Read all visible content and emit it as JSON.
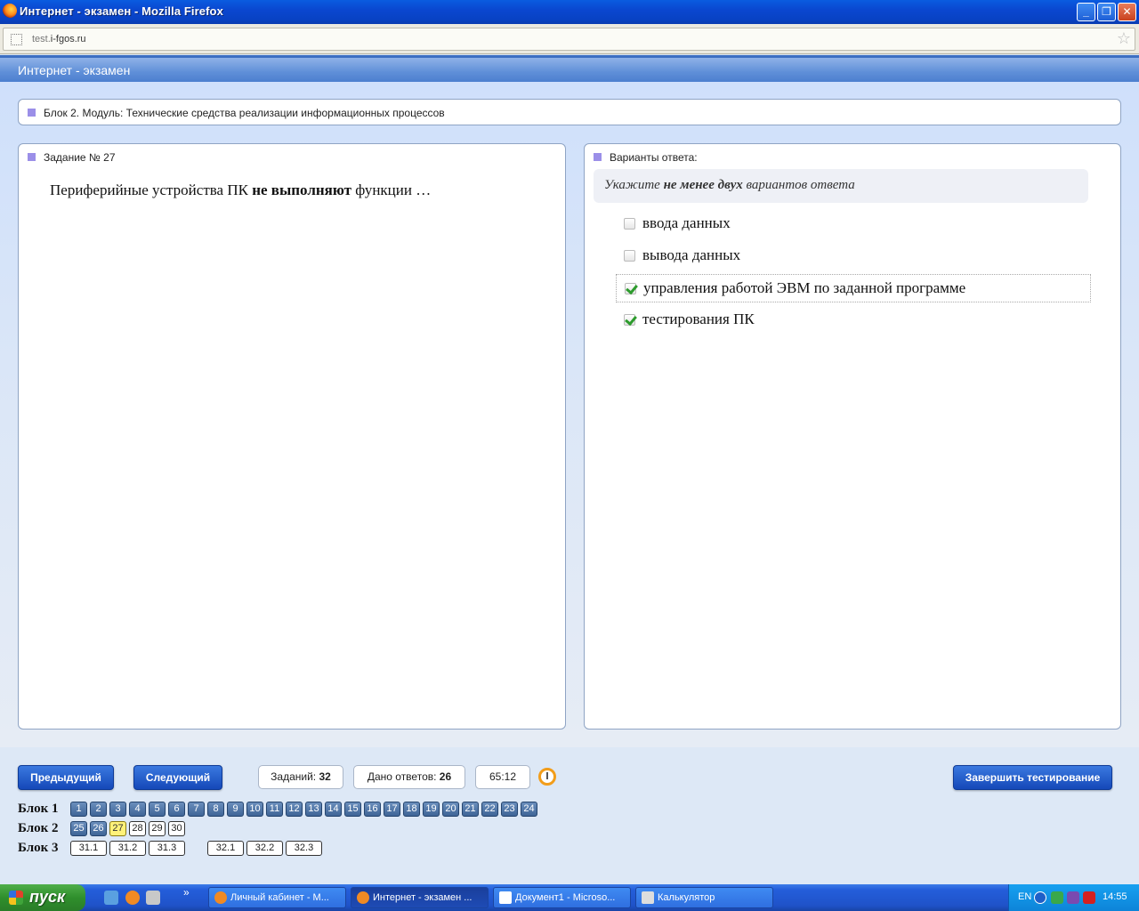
{
  "window": {
    "title": "Интернет - экзамен - Mozilla Firefox",
    "min_label": "_",
    "max_label": "❐",
    "close_label": "✕"
  },
  "browser": {
    "url_prefix": "test.",
    "url_domain": "i-fgos.ru"
  },
  "app": {
    "title": "Интернет - экзамен"
  },
  "block_header": "Блок 2. Модуль: Технические средства реализации информационных процессов",
  "task": {
    "header": "Задание № 27",
    "question_pre": "Периферийные устройства ПК ",
    "question_bold": "не выполняют",
    "question_post": " функции …"
  },
  "answers": {
    "header": "Варианты ответа:",
    "hint_pre": "Укажите ",
    "hint_bold": "не менее двух",
    "hint_post": " вариантов ответа",
    "options": [
      {
        "label": "ввода данных",
        "checked": false
      },
      {
        "label": "вывода данных",
        "checked": false
      },
      {
        "label": "управления работой ЭВМ по заданной программе",
        "checked": true
      },
      {
        "label": "тестирования ПК",
        "checked": true
      }
    ]
  },
  "controls": {
    "prev_label": "Предыдущий",
    "next_label": "Следующий",
    "finish_label": "Завершить тестирование",
    "tasks_label": "Заданий:",
    "tasks_count": "32",
    "answered_label": "Дано ответов:",
    "answered_count": "26",
    "timer": "65:12"
  },
  "navigation": {
    "block1_label": "Блок 1",
    "block2_label": "Блок 2",
    "block3_label": "Блок 3",
    "block1": [
      "1",
      "2",
      "3",
      "4",
      "5",
      "6",
      "7",
      "8",
      "9",
      "10",
      "11",
      "12",
      "13",
      "14",
      "15",
      "16",
      "17",
      "18",
      "19",
      "20",
      "21",
      "22",
      "23",
      "24"
    ],
    "block2": [
      {
        "n": "25",
        "state": "done"
      },
      {
        "n": "26",
        "state": "done"
      },
      {
        "n": "27",
        "state": "current"
      },
      {
        "n": "28",
        "state": "todo"
      },
      {
        "n": "29",
        "state": "todo"
      },
      {
        "n": "30",
        "state": "todo"
      }
    ],
    "block3": [
      "31.1",
      "31.2",
      "31.3",
      "32.1",
      "32.2",
      "32.3"
    ]
  },
  "taskbar": {
    "start_label": "пуск",
    "more": "»",
    "tasks": [
      "Личный кабинет - М...",
      "Интернет - экзамен ...",
      "Документ1 - Microso...",
      "Калькулятор"
    ],
    "lang": "EN",
    "time": "14:55"
  },
  "colors": {
    "accent": "#1548b8",
    "marker": "#9b8fe8",
    "current_task": "#fff27a",
    "checkmark": "#2d9b2d"
  }
}
